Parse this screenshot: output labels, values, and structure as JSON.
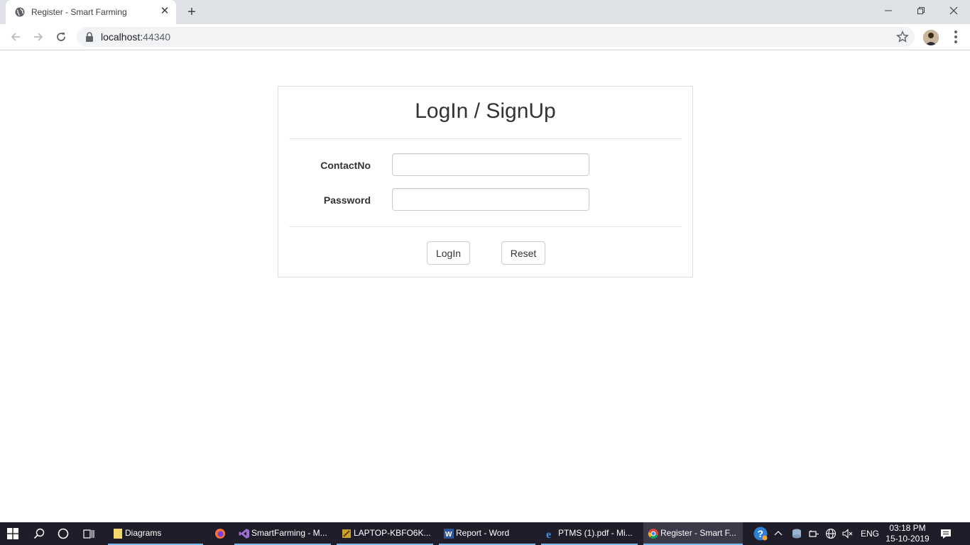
{
  "browser": {
    "tab_title": "Register - Smart Farming",
    "url_host": "localhost:",
    "url_port": "44340"
  },
  "page": {
    "heading": "LogIn / SignUp",
    "contact_label": "ContactNo",
    "contact_value": "",
    "password_label": "Password",
    "password_value": "",
    "login_button": "LogIn",
    "reset_button": "Reset"
  },
  "taskbar": {
    "items": [
      {
        "label": "Diagrams",
        "icon": "folder-icon"
      },
      {
        "label": "",
        "icon": "firefox-icon"
      },
      {
        "label": "SmartFarming - M...",
        "icon": "visual-studio-icon"
      },
      {
        "label": "LAPTOP-KBFO6K...",
        "icon": "sql-server-icon"
      },
      {
        "label": "Report - Word",
        "icon": "word-icon"
      },
      {
        "label": "PTMS (1).pdf - Mi...",
        "icon": "edge-icon"
      },
      {
        "label": "Register - Smart F...",
        "icon": "chrome-icon"
      }
    ],
    "language": "ENG",
    "time": "03:18 PM",
    "date": "15-10-2019"
  }
}
